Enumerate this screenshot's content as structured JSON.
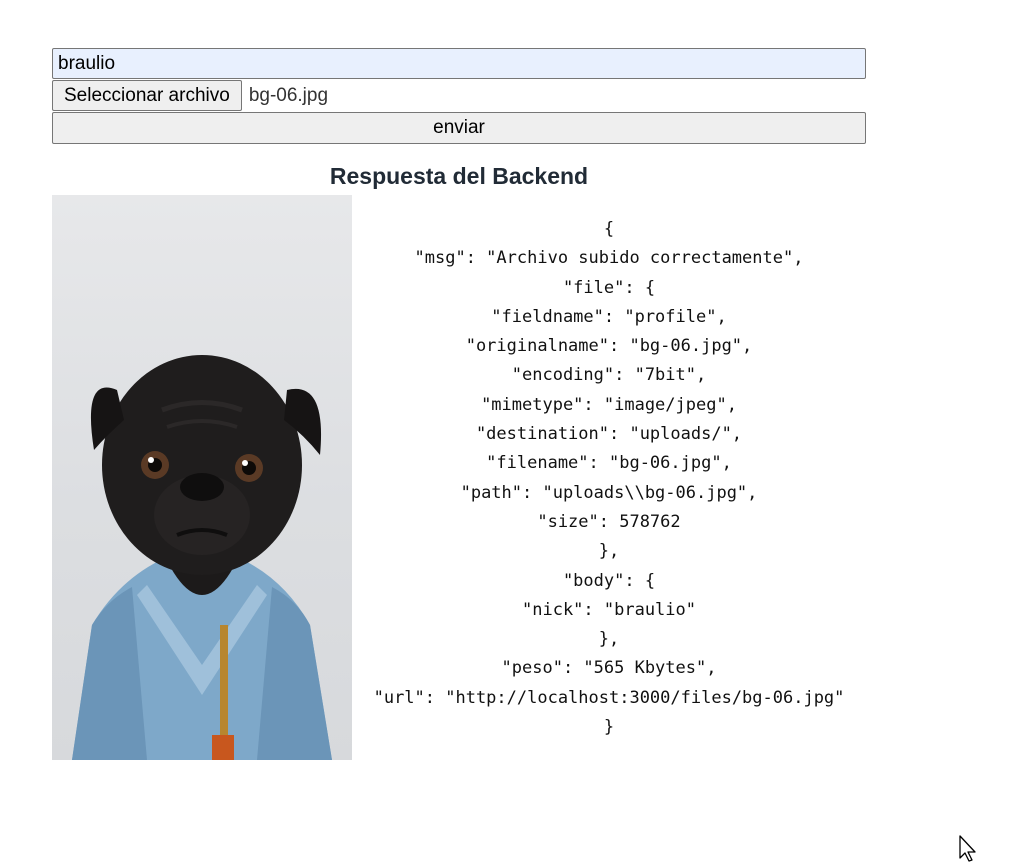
{
  "form": {
    "nick_value": "braulio",
    "file_button_label": "Seleccionar archivo",
    "file_name": "bg-06.jpg",
    "submit_label": "enviar"
  },
  "response": {
    "title": "Respuesta del Backend",
    "json_lines": [
      "{",
      "\"msg\": \"Archivo subido correctamente\",",
      "\"file\": {",
      "\"fieldname\": \"profile\",",
      "\"originalname\": \"bg-06.jpg\",",
      "\"encoding\": \"7bit\",",
      "\"mimetype\": \"image/jpeg\",",
      "\"destination\": \"uploads/\",",
      "\"filename\": \"bg-06.jpg\",",
      "\"path\": \"uploads\\\\bg-06.jpg\",",
      "\"size\": 578762",
      "},",
      "\"body\": {",
      "\"nick\": \"braulio\"",
      "},",
      "\"peso\": \"565 Kbytes\",",
      "\"url\": \"http://localhost:3000/files/bg-06.jpg\"",
      "}"
    ]
  },
  "icons": {
    "photo": "pug-in-denim-jacket-photo",
    "cursor": "mouse-pointer-icon"
  },
  "colors": {
    "input_autofill_bg": "#e8f0fe",
    "button_bg": "#efefef",
    "title_color": "#212b36"
  }
}
